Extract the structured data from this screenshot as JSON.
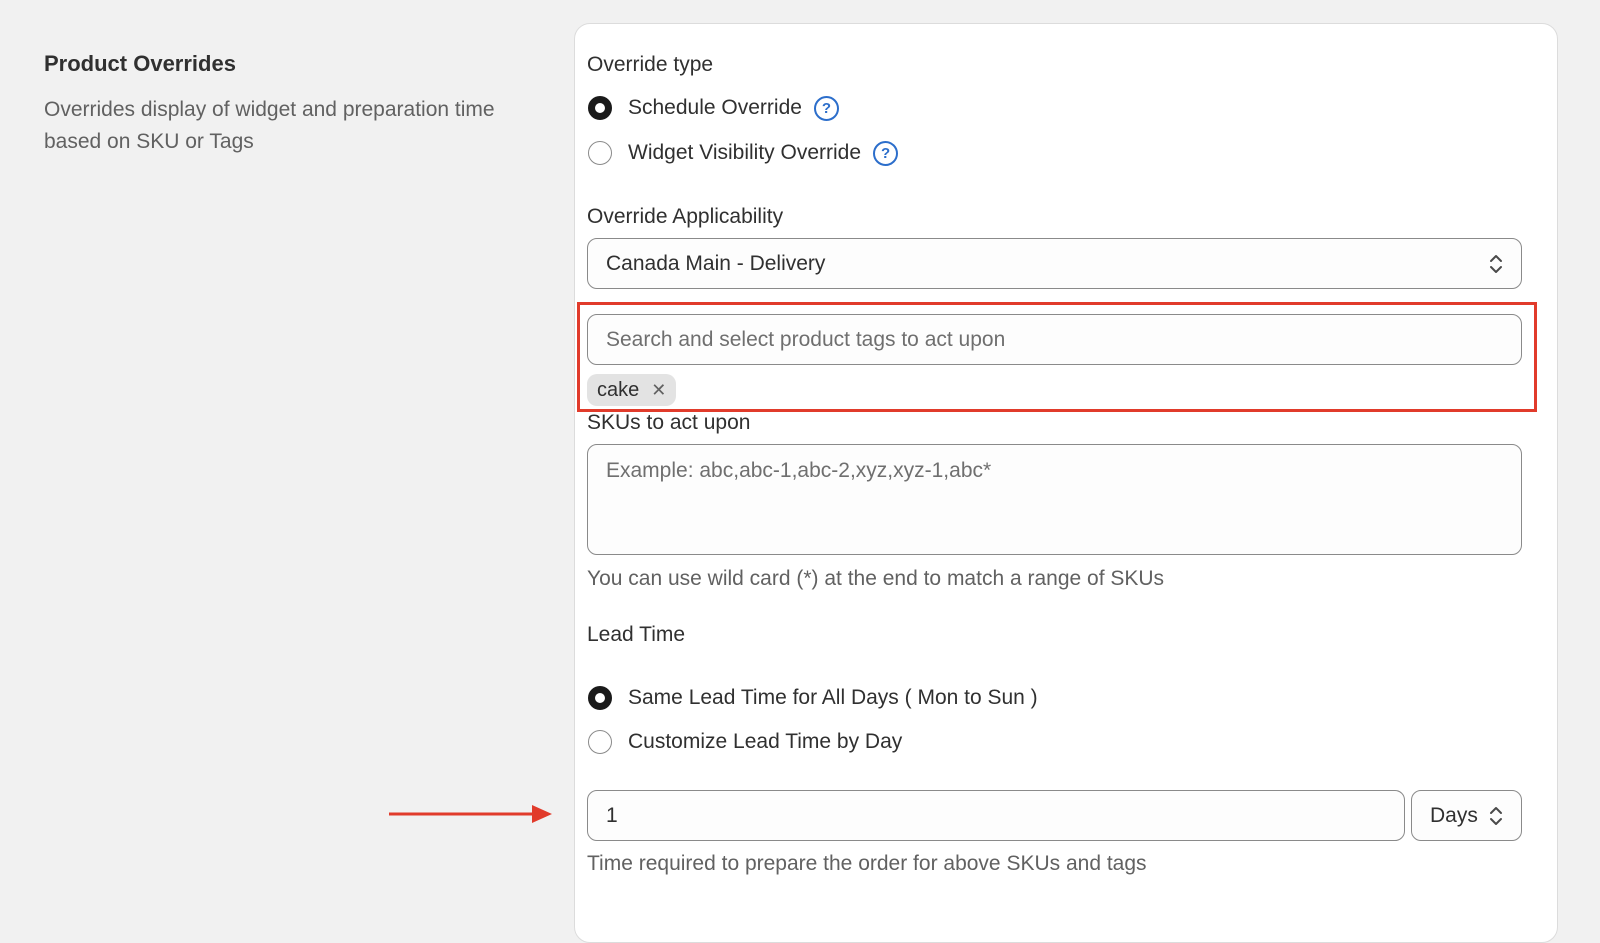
{
  "left": {
    "title": "Product Overrides",
    "description": "Overrides display of widget and preparation time based on SKU or Tags"
  },
  "override_type": {
    "label": "Override type",
    "options": [
      {
        "label": "Schedule Override",
        "checked": true,
        "help_icon": "question-circle-icon"
      },
      {
        "label": "Widget Visibility Override",
        "checked": false,
        "help_icon": "question-circle-icon"
      }
    ]
  },
  "override_applicability": {
    "label": "Override Applicability",
    "selected": "Canada Main - Delivery"
  },
  "product_tags": {
    "placeholder": "Search and select product tags to act upon",
    "tags": [
      {
        "label": "cake",
        "remove_icon": "close-icon"
      }
    ]
  },
  "skus": {
    "label": "SKUs to act upon",
    "placeholder": "Example: abc,abc-1,abc-2,xyz,xyz-1,abc*",
    "help": "You can use wild card (*) at the end to match a range of SKUs"
  },
  "lead_time": {
    "label": "Lead Time",
    "options": [
      {
        "label": "Same Lead Time for All Days ( Mon to Sun )",
        "checked": true
      },
      {
        "label": "Customize Lead Time by Day",
        "checked": false
      }
    ],
    "value": "1",
    "unit": "Days",
    "help": "Time required to prepare the order for above SKUs and tags"
  },
  "annotations": {
    "highlight_color": "#e13b2b",
    "arrow_color": "#e13b2b"
  }
}
